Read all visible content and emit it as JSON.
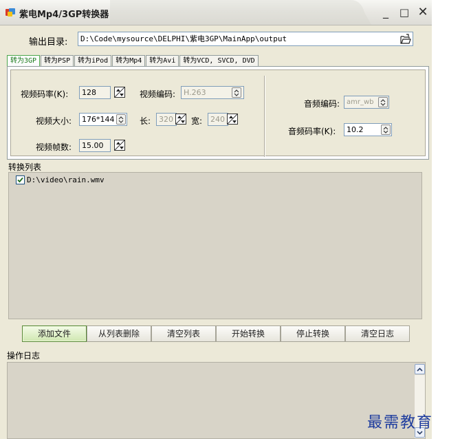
{
  "window": {
    "title": "紫电Mp4/3GP转换器",
    "min_symbol": "_",
    "max_symbol": "□",
    "close_symbol": "✕"
  },
  "output": {
    "label": "输出目录:",
    "path": "D:\\Code\\mysource\\DELPHI\\紫电3GP\\MainApp\\output"
  },
  "tabs": [
    {
      "label": "转为3GP",
      "active": true
    },
    {
      "label": "转为PSP"
    },
    {
      "label": "转为iPod"
    },
    {
      "label": "转为Mp4"
    },
    {
      "label": "转为Avi"
    },
    {
      "label": "转为VCD, SVCD, DVD"
    }
  ],
  "video": {
    "bitrate_label": "视频码率(K):",
    "bitrate_value": "128",
    "codec_label": "视频编码:",
    "codec_value": "H.263",
    "size_label": "视频大小:",
    "size_value": "176*144",
    "length_label": "长:",
    "length_value": "320",
    "width_label": "宽:",
    "width_value": "240",
    "fps_label": "视频帧数:",
    "fps_value": "15.00"
  },
  "audio": {
    "codec_label": "音频编码:",
    "codec_value": "amr_wb",
    "bitrate_label": "音频码率(K):",
    "bitrate_value": "10.2"
  },
  "convert_list": {
    "title": "转换列表",
    "items": [
      {
        "path": "D:\\video\\rain.wmv",
        "checked": true
      }
    ]
  },
  "buttons": {
    "add_file": "添加文件",
    "remove_from_list": "从列表删除",
    "clear_list": "清空列表",
    "start_convert": "开始转换",
    "stop_convert": "停止转换",
    "clear_log": "清空日志"
  },
  "log": {
    "title": "操作日志"
  },
  "watermark": "最需教育",
  "colors": {
    "window_bg": "#ece9d8",
    "active_tab": "#1a7a1a",
    "watermark": "#1e3c9e"
  }
}
